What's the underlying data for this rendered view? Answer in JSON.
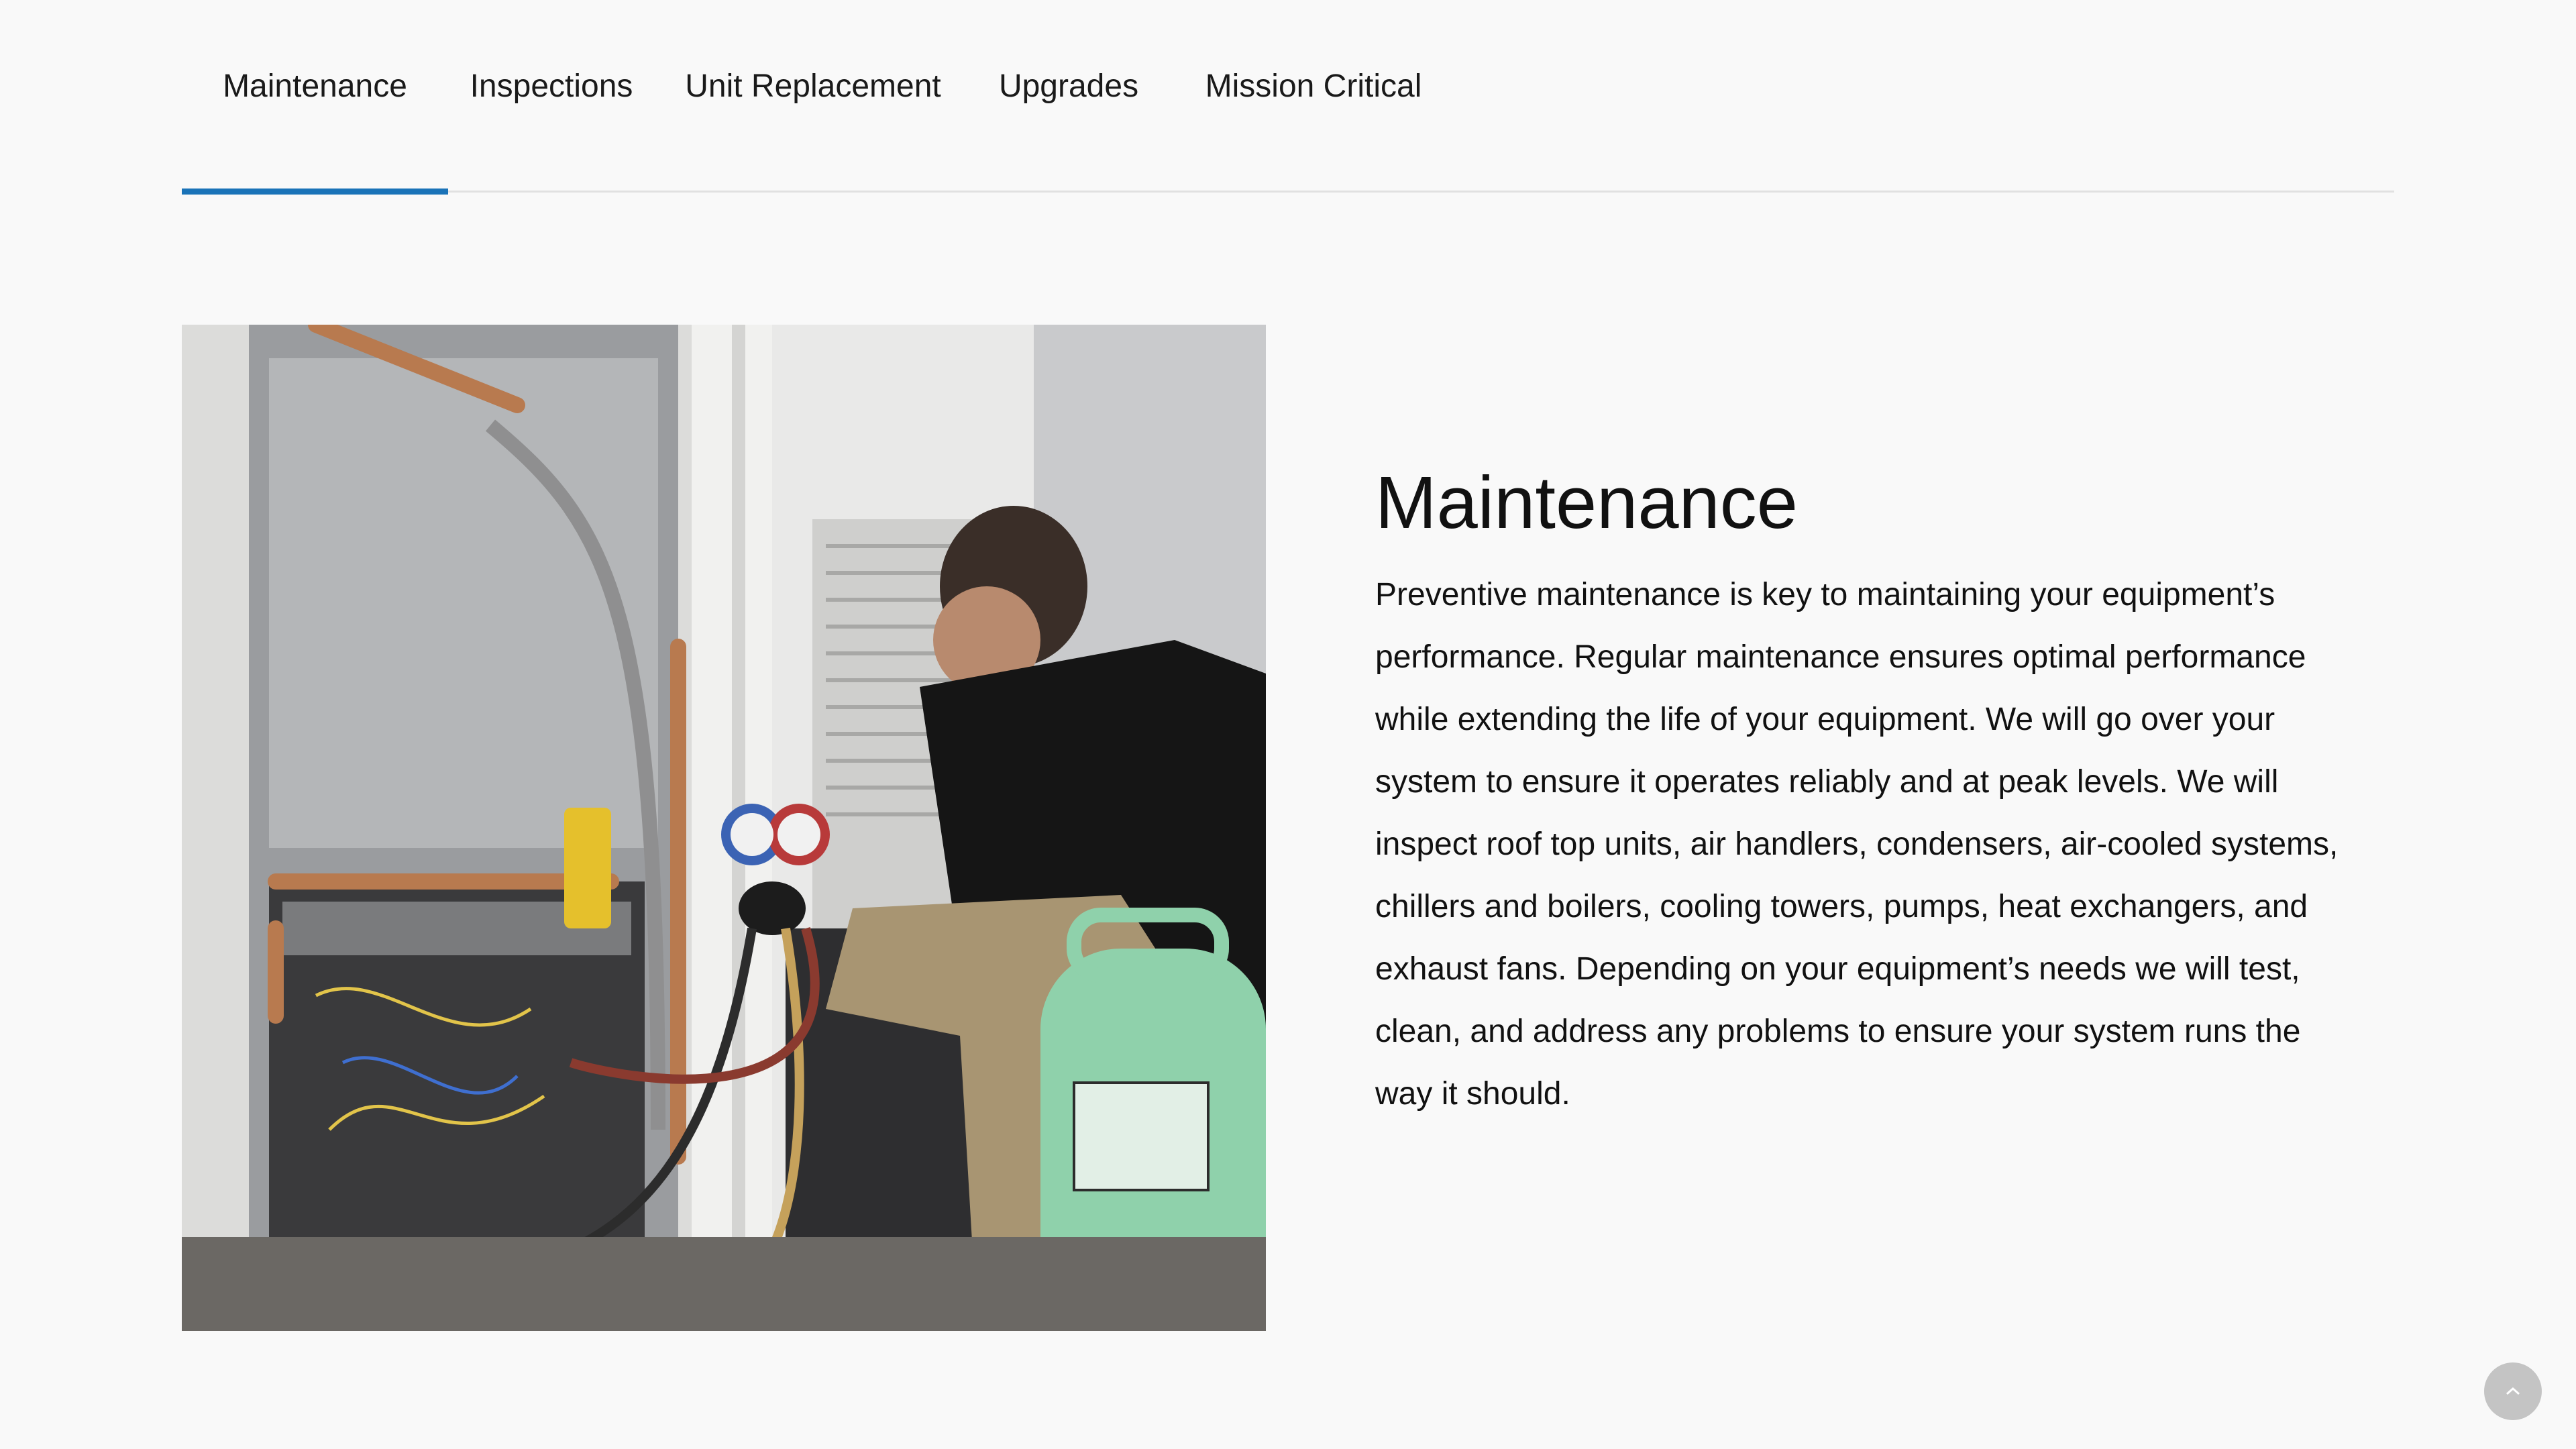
{
  "tabs": [
    {
      "label": "Maintenance",
      "active": true
    },
    {
      "label": "Inspections",
      "active": false
    },
    {
      "label": "Unit Replacement",
      "active": false
    },
    {
      "label": "Upgrades",
      "active": false
    },
    {
      "label": "Mission Critical",
      "active": false
    }
  ],
  "content": {
    "heading": "Maintenance",
    "body": "Preventive maintenance is key to maintaining your equipment’s performance. Regular maintenance ensures optimal performance while extending the life of your equipment. We will go over your system to ensure it operates reliably and at peak levels. We will inspect roof top units, air handlers, condensers, air-cooled systems, chillers and boilers, cooling towers, pumps, heat exchangers, and exhaust fans. Depending on your equipment’s needs we will test, clean, and address any problems to ensure your system runs the way it should."
  },
  "colors": {
    "accent": "#1a73b8",
    "background": "#f9f9f9",
    "text": "#111111"
  },
  "icons": {
    "scroll_top": "chevron-up-icon"
  }
}
